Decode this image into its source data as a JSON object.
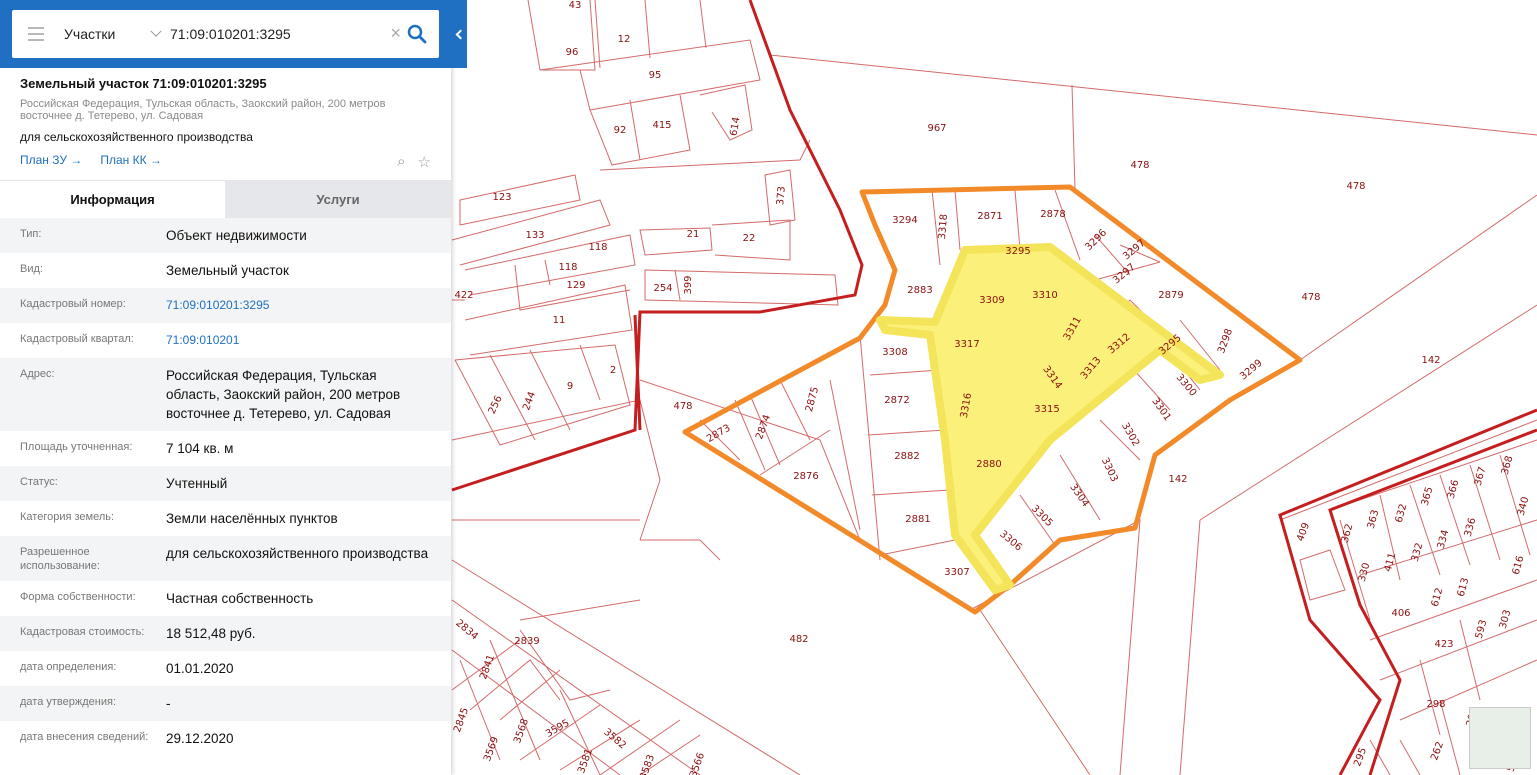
{
  "search": {
    "type_label": "Участки",
    "query": "71:09:010201:3295"
  },
  "object": {
    "title": "Земельный участок 71:09:010201:3295",
    "address": "Российская Федерация, Тульская область, Заокский район, 200 метров восточнее д. Тетерево, ул. Садовая",
    "usage": "для сельскохозяйственного производства",
    "links": [
      "План ЗУ →",
      "План КК →"
    ]
  },
  "tabs": [
    "Информация",
    "Услуги"
  ],
  "info": [
    {
      "key": "Тип:",
      "value": "Объект недвижимости"
    },
    {
      "key": "Вид:",
      "value": "Земельный участок"
    },
    {
      "key": "Кадастровый номер:",
      "value": "71:09:010201:3295",
      "link": true
    },
    {
      "key": "Кадастровый квартал:",
      "value": "71:09:010201",
      "link": true
    },
    {
      "key": "Адрес:",
      "value": "Российская Федерация, Тульская область, Заокский район, 200 метров восточнее д. Тетерево, ул. Садовая"
    },
    {
      "key": "Площадь уточненная:",
      "value": "7 104 кв. м"
    },
    {
      "key": "Статус:",
      "value": "Учтенный"
    },
    {
      "key": "Категория земель:",
      "value": "Земли населённых пунктов"
    },
    {
      "key": "Разрешенное использование:",
      "value": "для сельскохозяйственного производства"
    },
    {
      "key": "Форма собственности:",
      "value": "Частная собственность"
    },
    {
      "key": "Кадастровая стоимость:",
      "value": "18 512,48 руб."
    },
    {
      "key": "дата определения:",
      "value": "01.01.2020"
    },
    {
      "key": "дата утверждения:",
      "value": "-"
    },
    {
      "key": "дата внесения сведений:",
      "value": "29.12.2020"
    }
  ],
  "map": {
    "colors": {
      "boundary": "#c41e1e",
      "thin": "#d46a6a",
      "selected_outline": "#f38a2a",
      "selected_fill": "#fbf07a",
      "label": "#8a1010"
    },
    "plot_labels": [
      "43",
      "96",
      "12",
      "95",
      "92",
      "415",
      "614",
      "967",
      "478",
      "478",
      "478",
      "478",
      "123",
      "373",
      "133",
      "118",
      "21",
      "22",
      "118",
      "129",
      "254",
      "399",
      "422",
      "11",
      "256",
      "244",
      "9",
      "2",
      "3294",
      "3318",
      "2871",
      "2878",
      "3296",
      "3297",
      "3297",
      "2879",
      "3295",
      "3295",
      "2883",
      "3309",
      "3310",
      "3311",
      "3312",
      "3313",
      "3298",
      "3299",
      "3300",
      "3308",
      "3317",
      "3314",
      "3301",
      "3302",
      "2872",
      "3316",
      "3315",
      "142",
      "142",
      "2873",
      "2874",
      "2875",
      "2882",
      "2880",
      "3303",
      "3304",
      "2876",
      "2881",
      "3305",
      "3306",
      "3307",
      "482",
      "2834",
      "2839",
      "2841",
      "3595",
      "2845",
      "3568",
      "3569",
      "3582",
      "3581",
      "3583",
      "3566",
      "409",
      "362",
      "363",
      "632",
      "365",
      "366",
      "367",
      "368",
      "340",
      "330",
      "411",
      "332",
      "334",
      "336",
      "616",
      "406",
      "612",
      "613",
      "593",
      "303",
      "423",
      "298",
      "295",
      "262",
      "51",
      "306"
    ]
  }
}
